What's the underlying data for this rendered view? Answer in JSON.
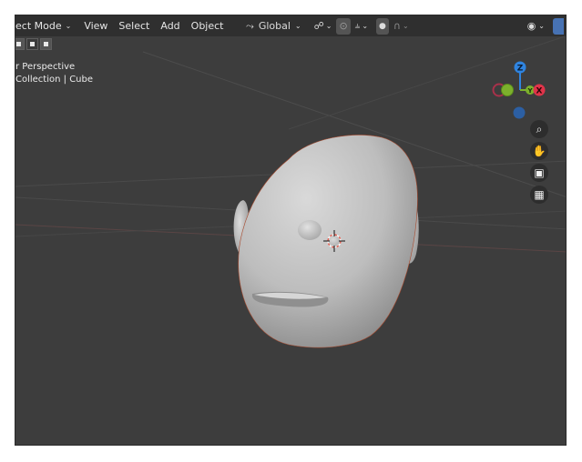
{
  "header": {
    "mode": "ect Mode",
    "menus": [
      "View",
      "Select",
      "Add",
      "Object"
    ],
    "orientation": "Global"
  },
  "viewport": {
    "view_name": "r Perspective",
    "collection": "Collection | Cube"
  },
  "gizmo": {
    "z_label": "Z",
    "y_label": "Y",
    "x_label": "X",
    "colors": {
      "x": "#e0344a",
      "y": "#7cb02c",
      "z": "#2f84e0",
      "neg": "#2c5fa3"
    }
  },
  "navigation": {
    "icons": [
      "zoom-icon",
      "hand-icon",
      "camera-icon",
      "grid-icon"
    ]
  },
  "colors": {
    "viewport_bg": "#3d3d3d",
    "header_bg": "#2f2f2f",
    "accent": "#4772b3"
  }
}
